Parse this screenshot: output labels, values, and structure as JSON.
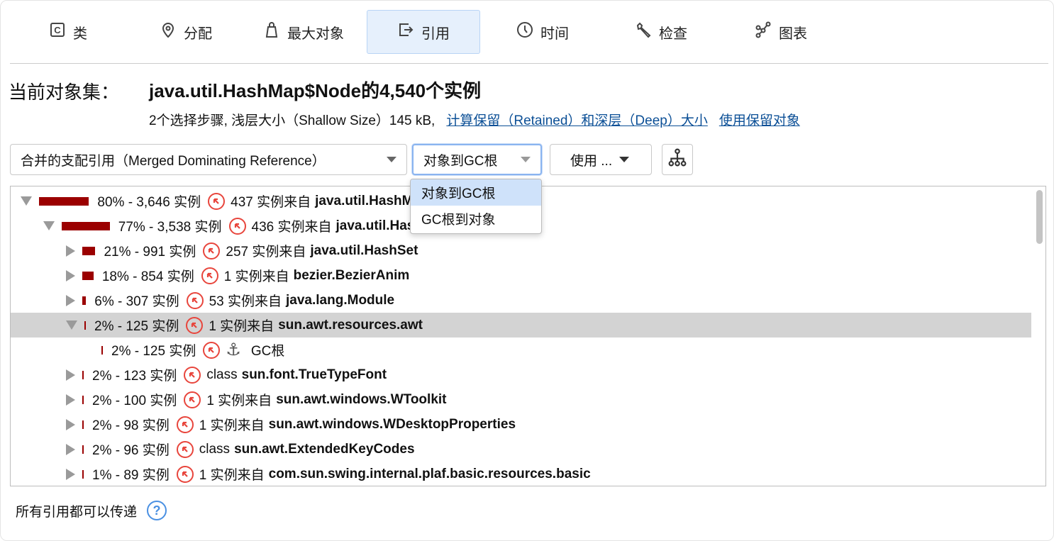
{
  "tabs": [
    {
      "label": "类",
      "icon": "class-icon"
    },
    {
      "label": "分配",
      "icon": "location-pin-icon"
    },
    {
      "label": "最大对象",
      "icon": "bag-icon"
    },
    {
      "label": "引用",
      "icon": "reference-icon",
      "active": true
    },
    {
      "label": "时间",
      "icon": "clock-icon"
    },
    {
      "label": "检查",
      "icon": "wrench-icon"
    },
    {
      "label": "图表",
      "icon": "graph-icon"
    }
  ],
  "header": {
    "label": "当前对象集：",
    "title": "java.util.HashMap$Node的4,540个实例",
    "info": "2个选择步骤, 浅层大小（Shallow Size）145 kB,",
    "link1": "计算保留（Retained）和深层（Deep）大小",
    "link2": "使用保留对象"
  },
  "toolbar": {
    "view_select": "合并的支配引用（Merged Dominating Reference）",
    "direction_select": "对象到GC根",
    "use_button": "使用 ...",
    "direction_options": [
      "对象到GC根",
      "GC根到对象"
    ]
  },
  "tree": [
    {
      "level": 0,
      "state": "exp",
      "pct": 80,
      "label": "80% - 3,646 实例",
      "prefix": "437 实例来自",
      "cls": "java.util.HashMap$Node"
    },
    {
      "level": 1,
      "state": "exp",
      "pct": 77,
      "label": "77% - 3,538 实例",
      "prefix": "436 实例来自",
      "cls": "java.util.HashMap$Node"
    },
    {
      "level": 2,
      "state": "col",
      "pct": 21,
      "label": "21% - 991 实例",
      "prefix": "257 实例来自",
      "cls": "java.util.HashSet"
    },
    {
      "level": 2,
      "state": "col",
      "pct": 18,
      "label": "18% - 854 实例",
      "prefix": "1 实例来自",
      "cls": "bezier.BezierAnim"
    },
    {
      "level": 2,
      "state": "col",
      "pct": 6,
      "label": "6% - 307 实例",
      "prefix": "53 实例来自",
      "cls": "java.lang.Module"
    },
    {
      "level": 2,
      "state": "exp",
      "pct": 2,
      "label": "2% - 125 实例",
      "prefix": "1 实例来自",
      "cls": "sun.awt.resources.awt",
      "selected": true
    },
    {
      "level": 3,
      "state": "none",
      "pct": 2,
      "label": "2% - 125 实例",
      "prefix": "GC根",
      "cls": "",
      "anchor": true
    },
    {
      "level": 2,
      "state": "col",
      "pct": 2,
      "label": "2% - 123 实例",
      "prefix": "class",
      "cls": "sun.font.TrueTypeFont"
    },
    {
      "level": 2,
      "state": "col",
      "pct": 2,
      "label": "2% - 100 实例",
      "prefix": "1 实例来自",
      "cls": "sun.awt.windows.WToolkit"
    },
    {
      "level": 2,
      "state": "col",
      "pct": 2,
      "label": "2% - 98 实例",
      "prefix": "1 实例来自",
      "cls": "sun.awt.windows.WDesktopProperties"
    },
    {
      "level": 2,
      "state": "col",
      "pct": 2,
      "label": "2% - 96 实例",
      "prefix": "class",
      "cls": "sun.awt.ExtendedKeyCodes"
    },
    {
      "level": 2,
      "state": "col",
      "pct": 1,
      "label": "1% - 89 实例",
      "prefix": "1 实例来自",
      "cls": "com.sun.swing.internal.plaf.basic.resources.basic"
    }
  ],
  "footer": {
    "text": "所有引用都可以传递",
    "help": "?"
  }
}
